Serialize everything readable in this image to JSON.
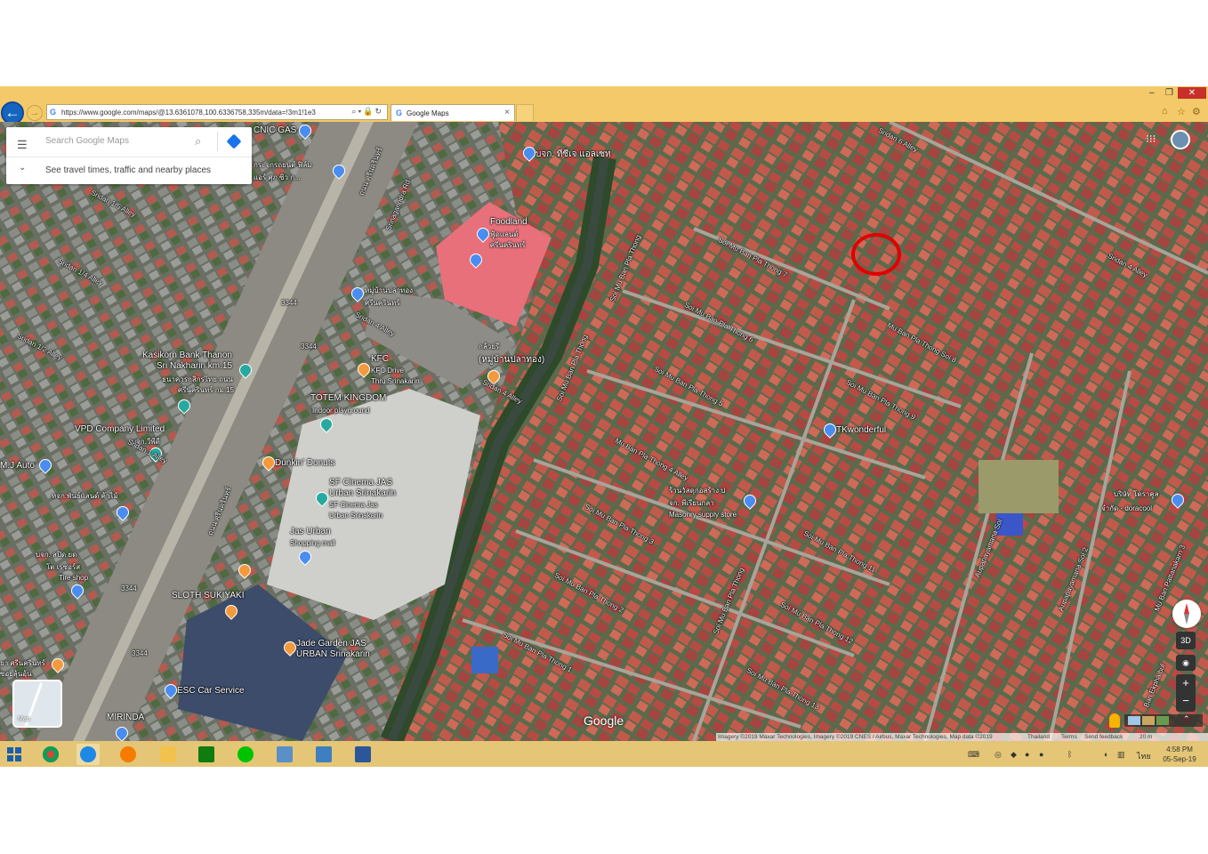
{
  "browser": {
    "url": "https://www.google.com/maps/@13.6361078,100.6336758,335m/data=!3m1!1e3",
    "tab_title": "Google Maps",
    "tab_close": "×"
  },
  "search": {
    "placeholder": "Search Google Maps",
    "travel_text": "See travel times, traffic and nearby places"
  },
  "map_labels": {
    "picnic_gas": "CNIC GAS",
    "thai_top_left_1": "กระจกรถยนต์ ฟิล์ม",
    "thai_top_left_2": "แอร์ ศุภ ซิว ก...",
    "mgg_hibuss": "บจก. ทีซีเจ แอลเซท",
    "foodland": "Foodland",
    "foodland_thai_1": "ฟู้ดแลนด์",
    "foodland_thai_2": "ศรีนครินทร์",
    "mu_ban_plathong_thai_1": "หมู่บ้านปลาทอง",
    "mu_ban_plathong_thai_2": "ศรีนครินทร์",
    "kasikorn_1": "Kasikorn Bank Thanon",
    "kasikorn_2": "Sri Nakharin km.15",
    "kasikorn_thai_1": "ธนาคารกสิกรไทย ถนน",
    "kasikorn_thai_2": "ศรีนครินทร์ กม.15",
    "kfc": "KFC",
    "kfc_sub_1": "KFC Drive",
    "kfc_sub_2": "Thru Srinakarin",
    "kluay_thai_1": "กล้วยรี",
    "kluay_thai_2": "(หมู่บ้านปลาทอง)",
    "totem": "TOTEM KINGDOM",
    "totem_sub": "Indoor playground",
    "vpd": "VPD Company Limited",
    "vpd_thai": "บจก.วีพีดี",
    "mj_auto": "M.J Auto",
    "dunkin": "Dunkin' Donuts",
    "sf_1": "SF Cinema JAS",
    "sf_2": "Urban Srinakarin",
    "sf_sub_1": "SF Cinema Jas",
    "sf_sub_2": "Urban Srinakarin",
    "jas_urban": "Jas Urban",
    "jas_urban_sub": "Shopping mall",
    "thai_left_mid": "หจก.พันธ์แลนด์ ค้าไม้",
    "thai_left_low_1": "บจก. สปิด ยด",
    "thai_left_low_2": "โต เรซอร์ส",
    "tire_shop": "Tire shop",
    "sloth": "SLOTH SUKIYAKI",
    "jade_1": "Jade Garden JAS",
    "jade_2": "URBAN Srinakarin",
    "esc": "ESC Car Service",
    "mirinda": "MIRINDA",
    "thai_bottom_left_1": "ยา ศรีนครินทร์",
    "thai_bottom_left_2": "ซอยลุ้นอุ้น",
    "tkwonderful": "TKwonderful",
    "masonry_thai_1": "ร้านวัสดุก่อสร้าง ป",
    "masonry_thai_2": "จก. พีเรียนกลา",
    "masonry": "Masonry supply store",
    "doracool_thai": "บริษัท โดราคูล",
    "doracool": "จำกัด - doracool",
    "road_srinagarindra": "Srinagarindra Rd",
    "road_3344_a": "3344",
    "road_3344_b": "3344",
    "road_3344_c": "3344",
    "road_3344_d": "3344",
    "road_sridan_5": "Sridan 1/5 Alley",
    "road_sridan_4": "Sridan 1/4 Alley",
    "road_sridan_2": "Sridan 1/2 Alley",
    "road_sridan_4b": "Sridan 4 Alley",
    "road_sridan_4c": "Sridan 4 Alley",
    "road_sridan_1": "Sridan 1 Alley",
    "road_sridan_6": "Sridan 6 Alley",
    "road_sridan_4d": "Sridan 4 Alley",
    "road_soi7": "Soi Mu Ban Pla Thong 7",
    "road_soi6": "Soi Mu Ban Pla Thong 6",
    "road_soi5": "Soi Mu Ban Pla Thong 5",
    "road_soi8": "Mu Ban Pla Thong Soi 8",
    "road_soi9": "Soi Mu Ban Pla Thong 9",
    "road_soi4": "Mu Ban Pla Thong 4 Alley",
    "road_soi3": "Soi Mu Ban Pla Thong 3",
    "road_soi2": "Soi Mu Ban Pla Thong 2",
    "road_soi1": "Soi Mu Ban Pla Thong 1",
    "road_soi11": "Soi Mu Ban Pla Thong 11",
    "road_soi12": "Soi Mu Ban Pla Thong 12",
    "road_soi13": "Soi Mu Ban Pla Thong 13",
    "road_pla_thong_v1": "Soi Mu Ban Pla Thong",
    "road_pla_thong_v2": "Soi Mu Ban Pla Thong",
    "road_pla_thong_v3": "Soi Mu Ban Pla Thong",
    "road_aupa_1": "Aupapayamana Soi",
    "road_aupa_2": "Aupapayamana Soi 2",
    "road_sridan_rd": "ถนน ศรีนครินทร์",
    "road_sridan_rd2": "ถนน ศรีนครินทร์",
    "road_ekphaibul": "Ban Ekphaibul",
    "road_pattanakarn": "Mu Ban Pattanakarn 3"
  },
  "map_controls": {
    "label_3d": "3D",
    "zoom_in": "+",
    "zoom_out": "−",
    "minimap_label": "Map",
    "google": "Google"
  },
  "attribution": {
    "imagery": "Imagery ©2019 Maxar Technologies, Imagery ©2019 CNES / Airbus, Maxar Technologies, Map data ©2019",
    "country": "Thailand",
    "terms": "Terms",
    "feedback": "Send feedback",
    "scale": "20 m"
  },
  "taskbar": {
    "time": "4:58 PM",
    "date": "05-Sep-19",
    "lang": "ไทย"
  },
  "colors": {
    "browser_chrome": "#f3c969",
    "taskbar": "#e4c676",
    "highlight_circle": "#e00000",
    "pin_blue": "#4a8df0",
    "pin_orange": "#f29a3c"
  }
}
